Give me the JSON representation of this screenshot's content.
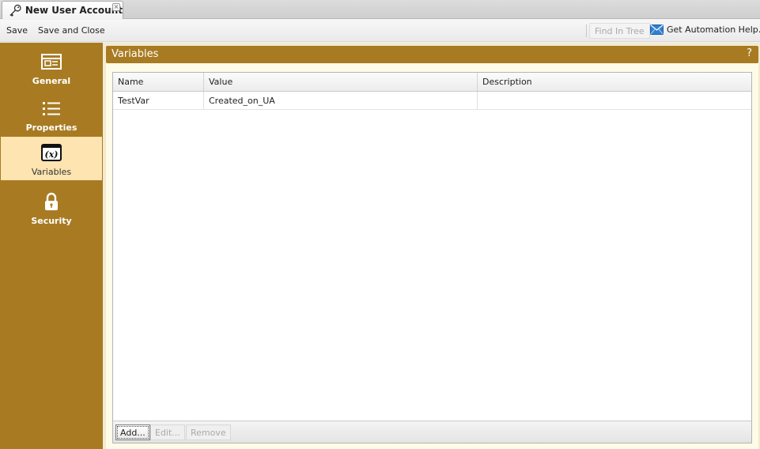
{
  "tab": {
    "title": "New User Account",
    "icon": "key-icon",
    "close_glyph": "×"
  },
  "toolbar": {
    "save_label": "Save",
    "save_close_label": "Save and Close",
    "find_in_tree_label": "Find In Tree",
    "automation_help_label": "Get Automation Help..."
  },
  "sidebar": {
    "items": [
      {
        "label": "General",
        "icon": "form-icon",
        "active": false
      },
      {
        "label": "Properties",
        "icon": "list-icon",
        "active": false
      },
      {
        "label": "Variables",
        "icon": "variable-icon",
        "active": true
      },
      {
        "label": "Security",
        "icon": "lock-icon",
        "active": false
      }
    ]
  },
  "panel": {
    "title": "Variables",
    "help_glyph": "?"
  },
  "grid": {
    "columns": [
      "Name",
      "Value",
      "Description"
    ],
    "rows": [
      {
        "name": "TestVar",
        "value": "Created_on_UA",
        "description": ""
      }
    ],
    "buttons": {
      "add": "Add...",
      "edit": "Edit...",
      "remove": "Remove"
    }
  },
  "colors": {
    "accent": "#a87b22",
    "active_nav": "#fde4b0",
    "panel_bg": "#fffbe9"
  }
}
